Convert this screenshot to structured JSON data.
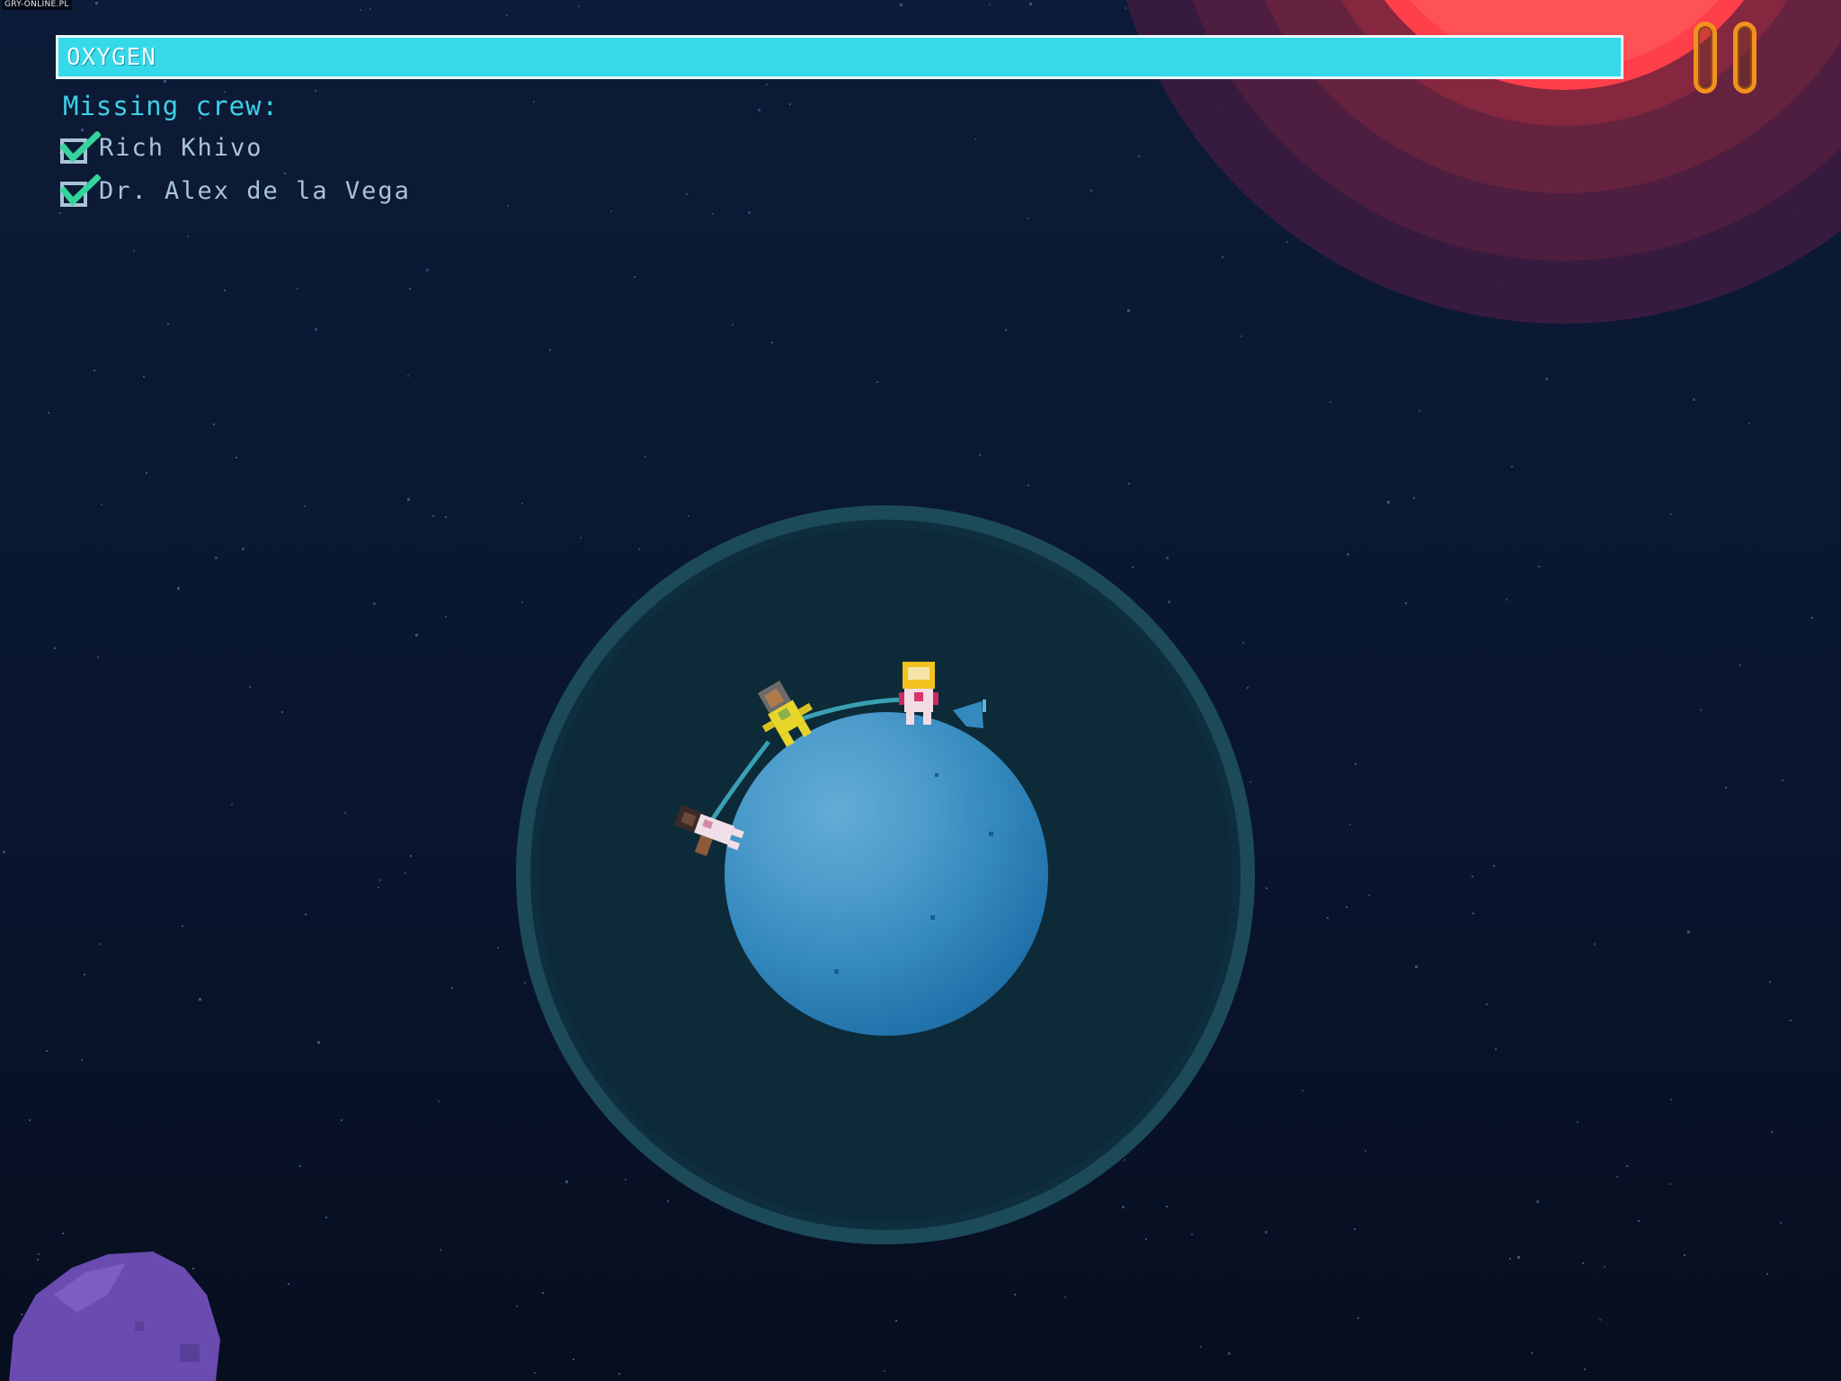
{
  "watermark": "GRY-ONLINE.PL",
  "hud": {
    "oxygen_label": "OXYGEN",
    "oxygen_level": 1.0,
    "oxygen_color": "#35d9ea",
    "pause_icon": "pause-icon",
    "pause_color": "#f2911b"
  },
  "crew": {
    "title": "Missing crew:",
    "check_color": "#34d39b",
    "members": [
      {
        "name": "Rich Khivo",
        "found": true
      },
      {
        "name": "Dr. Alex de la Vega",
        "found": true
      }
    ]
  },
  "scene": {
    "background_color": "#0b1a33",
    "planet_color": "#2f8ac4",
    "atmosphere_color": "#1d4a55",
    "sun_color": "#ff4a4f",
    "asteroid_color": "#6a4bb0"
  }
}
